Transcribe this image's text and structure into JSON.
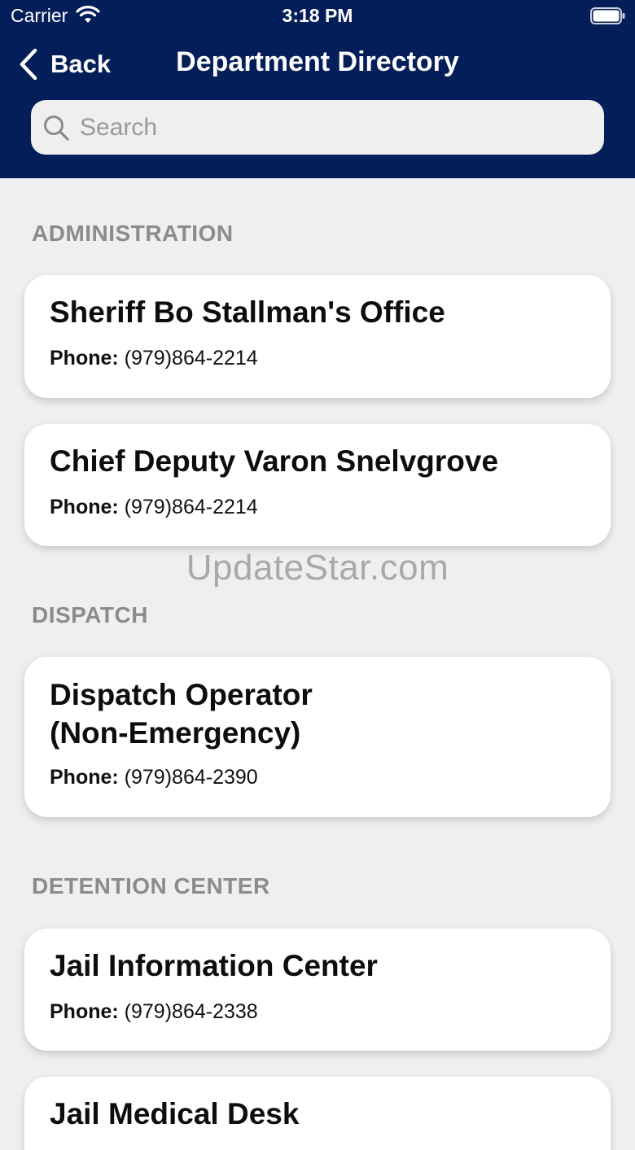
{
  "status_bar": {
    "carrier": "Carrier",
    "time": "3:18 PM"
  },
  "nav": {
    "back_label": "Back",
    "title": "Department Directory"
  },
  "search": {
    "placeholder": "Search",
    "value": ""
  },
  "phone_label": "Phone:",
  "sections": [
    {
      "title": "ADMINISTRATION",
      "items": [
        {
          "name": "Sheriff Bo Stallman's Office",
          "phone": "(979)864-2214"
        },
        {
          "name": "Chief Deputy Varon Snelvgrove",
          "phone": "(979)864-2214"
        }
      ]
    },
    {
      "title": "DISPATCH",
      "items": [
        {
          "name": "Dispatch Operator (Non-Emergency)",
          "phone": "(979)864-2390"
        }
      ]
    },
    {
      "title": "DETENTION CENTER",
      "items": [
        {
          "name": "Jail Information Center",
          "phone": "(979)864-2338"
        },
        {
          "name": "Jail Medical Desk",
          "phone": ""
        }
      ]
    }
  ],
  "watermark": "UpdateStar.com",
  "colors": {
    "header_bg": "#031e58",
    "page_bg": "#efefef",
    "section_header": "#8b8b8b"
  }
}
